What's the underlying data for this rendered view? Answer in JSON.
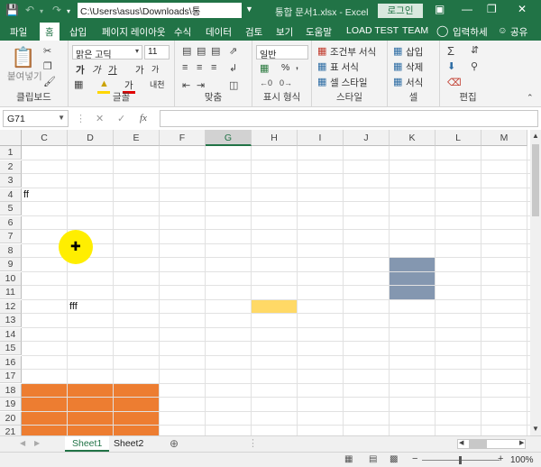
{
  "titlebar": {
    "path": "C:\\Users\\asus\\Downloads\\통",
    "title": "통합 문서1.xlsx  -  Excel",
    "login_label": "로그인"
  },
  "tabs": [
    "파일",
    "홈",
    "삽입",
    "페이지 레이아웃",
    "수식",
    "데이터",
    "검토",
    "보기",
    "도움말",
    "LOAD TEST",
    "TEAM",
    "입력하세",
    "공유"
  ],
  "active_tab": "홈",
  "ribbon": {
    "clipboard": {
      "label": "클립보드",
      "paste": "붙여넣기"
    },
    "font": {
      "label": "글꼴",
      "name": "맑은 고딕",
      "size": "11",
      "bold": "가",
      "italic": "가",
      "underline": "가",
      "grow": "가",
      "shrink": "가",
      "color_letter": "가",
      "phonetic": "내천"
    },
    "alignment": {
      "label": "맞춤"
    },
    "number": {
      "label": "표시 형식",
      "format": "일반",
      "percent": "%",
      "comma": ","
    },
    "styles": {
      "label": "스타일",
      "cond": "조건부 서식",
      "table": "표 서식",
      "cell": "셀 스타일"
    },
    "cells": {
      "label": "셀",
      "insert": "삽입",
      "delete": "삭제",
      "format": "서식"
    },
    "editing": {
      "label": "편집"
    }
  },
  "formula_bar": {
    "name_box": "G71",
    "fx": "fx",
    "value": ""
  },
  "columns": [
    "C",
    "D",
    "E",
    "F",
    "G",
    "H",
    "I",
    "J",
    "K",
    "L",
    "M"
  ],
  "selected_column": "G",
  "rows": [
    "1",
    "2",
    "3",
    "4",
    "5",
    "6",
    "7",
    "8",
    "9",
    "10",
    "11",
    "12",
    "13",
    "14",
    "15",
    "16",
    "17",
    "18",
    "19",
    "20",
    "21"
  ],
  "cells": [
    {
      "ref": "C4",
      "text": "ff"
    },
    {
      "ref": "D12",
      "text": "fff"
    }
  ],
  "fills": [
    {
      "range": "K9:K11",
      "color": "#8497b0"
    },
    {
      "range": "H12",
      "color": "#ffd966"
    },
    {
      "range": "C18:E21",
      "color": "#ed7d31"
    }
  ],
  "sheets": [
    "Sheet1",
    "Sheet2"
  ],
  "active_sheet": "Sheet1",
  "status": {
    "zoom": "100%"
  },
  "colors": {
    "accent": "#217346"
  }
}
